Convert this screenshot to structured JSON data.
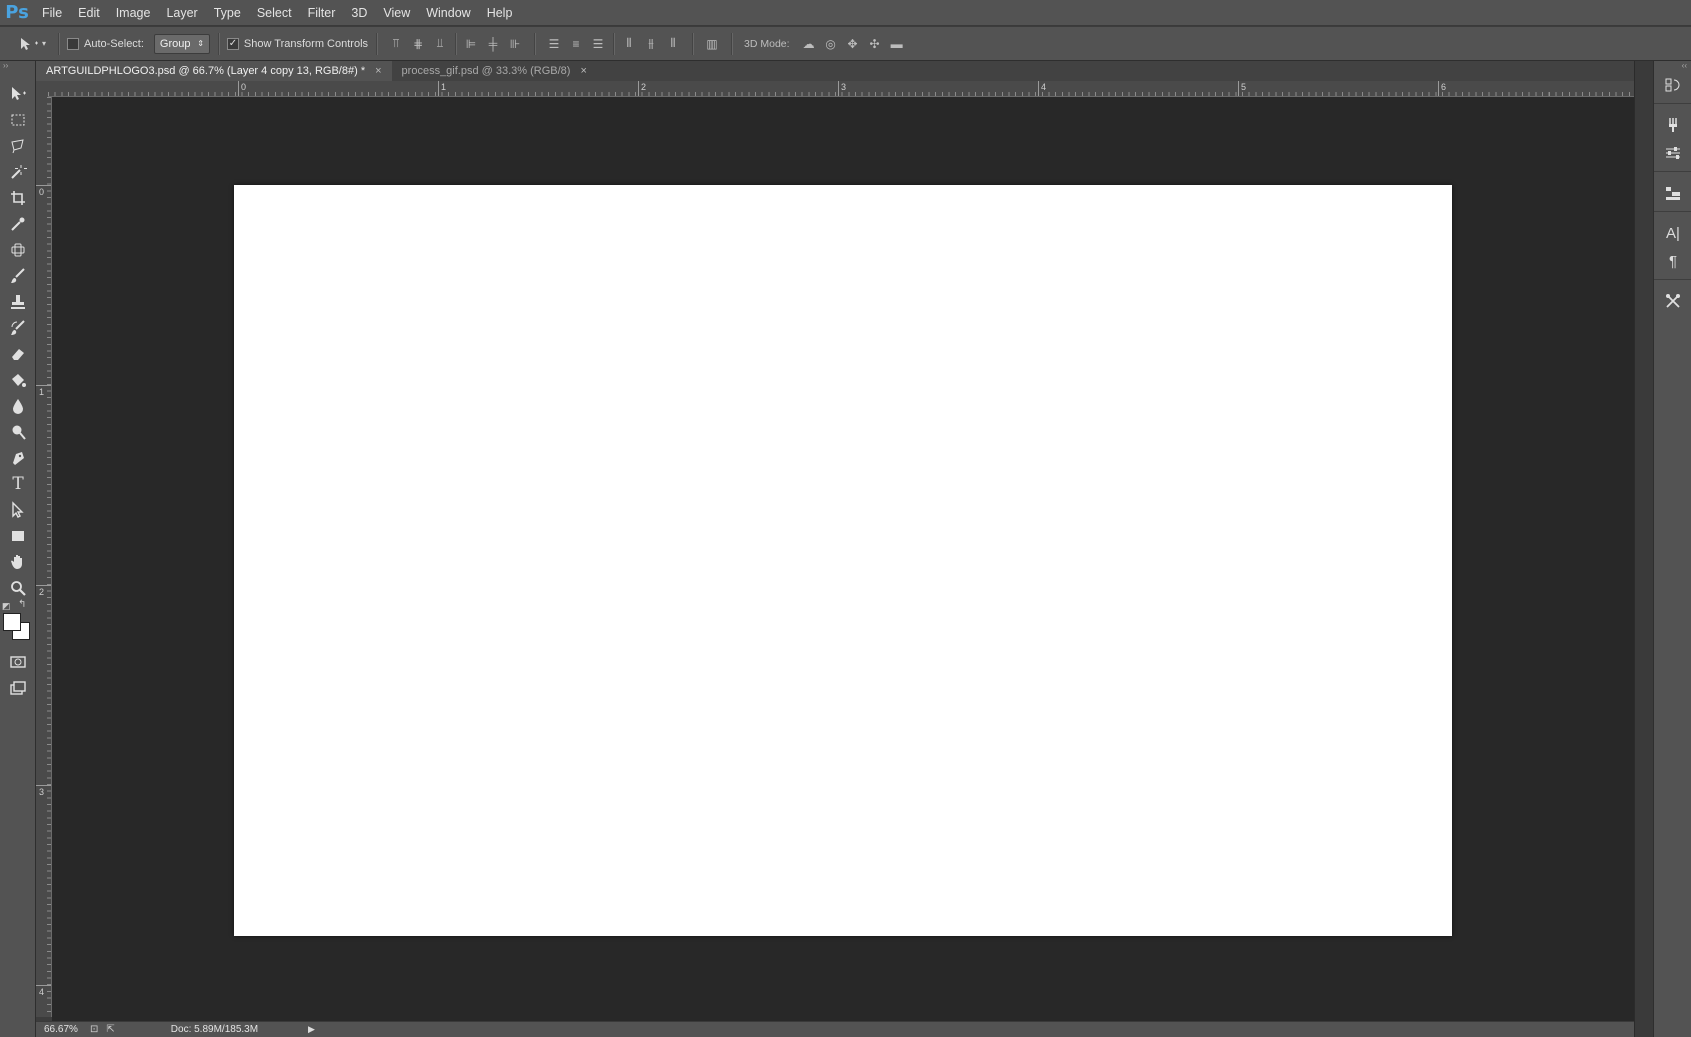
{
  "app": {
    "logo": "Ps",
    "brand_color": "#4aa3e0"
  },
  "menu": [
    {
      "label": "File"
    },
    {
      "label": "Edit"
    },
    {
      "label": "Image"
    },
    {
      "label": "Layer"
    },
    {
      "label": "Type"
    },
    {
      "label": "Select"
    },
    {
      "label": "Filter"
    },
    {
      "label": "3D"
    },
    {
      "label": "View"
    },
    {
      "label": "Window"
    },
    {
      "label": "Help"
    }
  ],
  "options": {
    "tool_icon": "move-tool-icon",
    "auto_select_label": "Auto-Select:",
    "auto_select_checked": false,
    "group_value": "Group",
    "show_transform_label": "Show Transform Controls",
    "show_transform_checked": true,
    "mode3d_label": "3D Mode:"
  },
  "tabs": [
    {
      "label": "ARTGUILDPHLOGO3.psd @ 66.7% (Layer 4 copy 13, RGB/8#) *",
      "active": true
    },
    {
      "label": "process_gif.psd @ 33.3% (RGB/8)",
      "active": false
    }
  ],
  "ruler_h_labels": [
    "0",
    "1",
    "2",
    "3",
    "4",
    "5",
    "6"
  ],
  "ruler_v_labels": [
    "0",
    "1",
    "2",
    "3",
    "4"
  ],
  "tools": [
    "move-tool-icon",
    "rectangular-marquee-icon",
    "lasso-icon",
    "magic-wand-icon",
    "crop-icon",
    "eyedropper-icon",
    "spot-healing-icon",
    "brush-icon",
    "clone-stamp-icon",
    "history-brush-icon",
    "eraser-icon",
    "paint-bucket-icon",
    "blur-icon",
    "dodge-icon",
    "pen-icon",
    "type-icon",
    "path-selection-icon",
    "rectangle-shape-icon",
    "hand-icon",
    "zoom-icon"
  ],
  "swatches": {
    "foreground": "#ffffff",
    "background": "#ffffff"
  },
  "right_panel_icons": [
    "history-panel-icon",
    "brush-presets-icon",
    "adjustments-icon",
    "layers-panel-icon",
    "character-panel-icon",
    "paragraph-panel-icon",
    "tool-presets-icon"
  ],
  "status": {
    "zoom": "66.67%",
    "doc_size": "Doc: 5.89M/185.3M"
  }
}
